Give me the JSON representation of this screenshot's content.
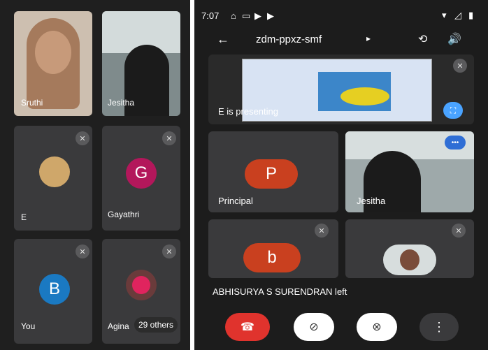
{
  "left_grid": {
    "tiles": [
      {
        "label": "Sruthi",
        "kind": "video"
      },
      {
        "label": "Jesitha",
        "kind": "video"
      },
      {
        "label": "E",
        "kind": "photo"
      },
      {
        "label": "Gayathri",
        "kind": "initial",
        "initial": "G",
        "color": "#b3175b"
      },
      {
        "label": "You",
        "kind": "initial",
        "initial": "B",
        "color": "#1a79c2"
      },
      {
        "label": "Agina",
        "kind": "photo",
        "others": "29 others"
      }
    ]
  },
  "status_bar": {
    "time": "7:07",
    "icons": [
      "cast-icon",
      "message-icon",
      "youtube-icon",
      "youtube-icon",
      "dot"
    ]
  },
  "top_bar": {
    "meeting_code": "zdm-ppxz-smf",
    "back_icon": "arrow-left-icon",
    "switch_camera_icon": "camera-switch-icon",
    "audio_icon": "speaker-icon"
  },
  "presentation": {
    "label": "E is presenting"
  },
  "tiles": [
    {
      "label": "Principal",
      "initial": "P",
      "color": "#c9401f"
    },
    {
      "label": "Jesitha",
      "kind": "video"
    },
    {
      "label": "",
      "initial": "b",
      "color": "#c9401f"
    },
    {
      "label": "",
      "kind": "photo"
    }
  ],
  "notification": "ABHISURYA S SURENDRAN left",
  "controls": {
    "end_call": "end-call-icon",
    "camera": "camera-off-icon",
    "mic": "mic-off-icon",
    "more": "more-vert-icon"
  },
  "colors": {
    "end_call": "#e0332d",
    "control_bg": "#ffffff"
  }
}
